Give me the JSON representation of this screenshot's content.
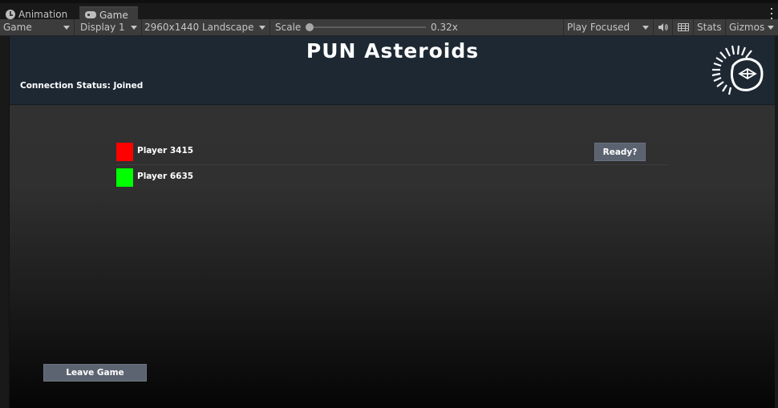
{
  "tabs": [
    {
      "label": "Animation",
      "icon": "clock-icon"
    },
    {
      "label": "Game",
      "icon": "gamepad-icon"
    }
  ],
  "toolbar": {
    "view_select": "Game",
    "display_select": "Display 1",
    "resolution_select": "2960x1440 Landscape",
    "scale_label": "Scale",
    "scale_value": "0.32x",
    "play_mode_select": "Play Focused",
    "stats_label": "Stats",
    "gizmos_label": "Gizmos"
  },
  "game": {
    "title": "PUN Asteroids",
    "connection_status": "Connection Status: Joined",
    "players": [
      {
        "name": "Player 3415",
        "color": "#ff0000",
        "button": "Ready?"
      },
      {
        "name": "Player 6635",
        "color": "#00ff00"
      }
    ],
    "leave_button": "Leave Game"
  },
  "colors": {
    "header_bg": "#1d2833",
    "button_bg": "#5b6270",
    "editor_toolbar": "#3c3c3c"
  }
}
